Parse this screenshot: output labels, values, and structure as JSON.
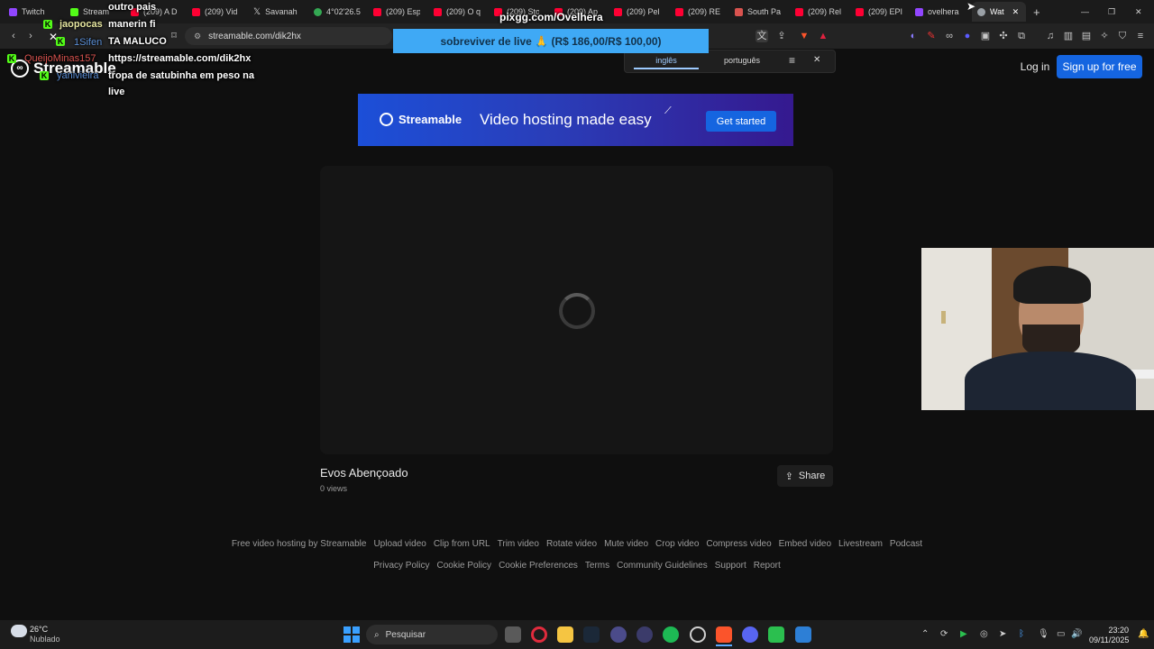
{
  "tabs": [
    {
      "label": "Twitch",
      "color": "#9146ff"
    },
    {
      "label": "Stream",
      "color": "#53fc18"
    },
    {
      "label": "(209) A D",
      "color": "#ff0033"
    },
    {
      "label": "(209) Vid",
      "color": "#ff0033"
    },
    {
      "label": "Savanah",
      "color": "#ffffff"
    },
    {
      "label": "4°02'26.5",
      "color": "#34a853"
    },
    {
      "label": "(209) Esp",
      "color": "#ff0033"
    },
    {
      "label": "(209) O q",
      "color": "#ff0033"
    },
    {
      "label": "(209) Sto",
      "color": "#ff0033"
    },
    {
      "label": "(209) Ap",
      "color": "#ff0033"
    },
    {
      "label": "(209) Pel",
      "color": "#ff0033"
    },
    {
      "label": "(209) RE",
      "color": "#ff0033"
    },
    {
      "label": "South Pa",
      "color": "#d9534f"
    },
    {
      "label": "(209) Rel",
      "color": "#ff0033"
    },
    {
      "label": "(209) EPI",
      "color": "#ff0033"
    },
    {
      "label": "ovelhera",
      "color": "#9146ff"
    },
    {
      "label": "Wat",
      "color": "#9aa0a6"
    }
  ],
  "address": {
    "url": "streamable.com/dik2hx"
  },
  "translate": {
    "tab_english": "inglês",
    "tab_portuguese": "português"
  },
  "overlay": {
    "pix_url": "pixgg.com/Ovelhera",
    "pix_goal": "sobreviver de live 🙏 (R$ 186,00/R$ 100,00)",
    "chat_names": [
      "jaopocas",
      "1Sifen",
      "QueijoMinas157",
      "yanivieira"
    ],
    "chat_lines": [
      "outro pais",
      "manerin fi",
      "TA MALUCO",
      "https://streamable.com/dik2hx",
      "tropa de satubinha em peso na",
      "live"
    ]
  },
  "site": {
    "logo": "Streamable",
    "login": "Log in",
    "signup": "Sign up for free",
    "banner_logo": "Streamable",
    "banner_text": "Video hosting made easy",
    "banner_cta": "Get started",
    "video_title": "Evos Abençoado",
    "video_views": "0 views",
    "share": "Share",
    "footer_row1": [
      "Free video hosting by Streamable",
      "Upload video",
      "Clip from URL",
      "Trim video",
      "Rotate video",
      "Mute video",
      "Crop video",
      "Compress video",
      "Embed video",
      "Livestream",
      "Podcast"
    ],
    "footer_row2": [
      "Privacy Policy",
      "Cookie Policy",
      "Cookie Preferences",
      "Terms",
      "Community Guidelines",
      "Support",
      "Report"
    ]
  },
  "taskbar": {
    "weather_temp": "26°C",
    "weather_desc": "Nublado",
    "search": "Pesquisar",
    "time": "23:20",
    "date": "09/11/2025"
  }
}
